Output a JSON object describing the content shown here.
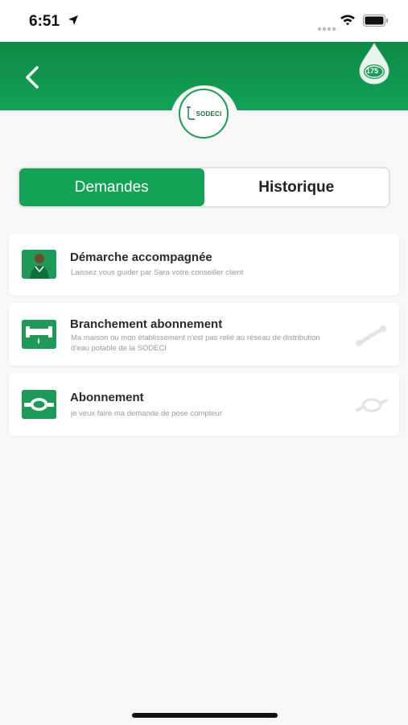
{
  "status": {
    "time": "6:51"
  },
  "header": {
    "logo_text": "SODECI",
    "badge_text": "175"
  },
  "tabs": [
    {
      "label": "Demandes",
      "active": true
    },
    {
      "label": "Historique",
      "active": false
    }
  ],
  "cards": [
    {
      "title": "Démarche accompagnée",
      "subtitle": "Laissez vous guider par Sara votre conseiller client"
    },
    {
      "title": "Branchement abonnement",
      "subtitle": "Ma maison ou mon établissement  n'est pas relié au réseau de distribution d'eau potable de la SODECI"
    },
    {
      "title": "Abonnement",
      "subtitle": "je veux faire ma demande de pose compteur"
    }
  ],
  "colors": {
    "brand_green": "#14a257",
    "header_green": "#0c8a45"
  }
}
